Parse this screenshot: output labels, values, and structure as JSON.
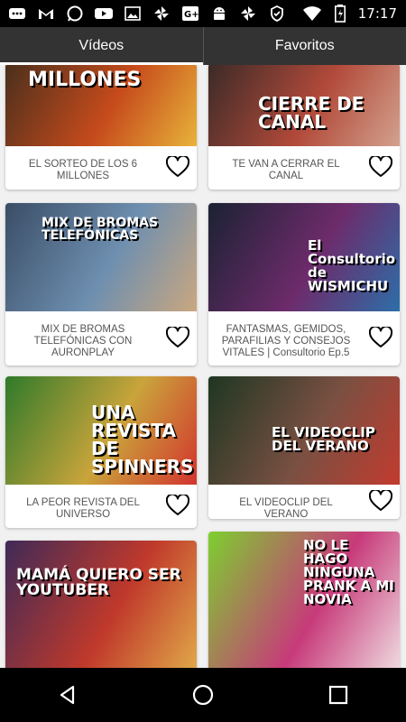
{
  "status_bar": {
    "time": "17:17",
    "icons": [
      "messages-icon",
      "gmail-icon",
      "whatsapp-icon",
      "youtube-icon",
      "gallery-icon",
      "pinwheel-icon",
      "google-plus-icon",
      "android-icon",
      "pinwheel-icon",
      "shield-icon",
      "wifi-icon",
      "battery-charging-icon"
    ]
  },
  "tabs": [
    {
      "label": "Vídeos",
      "active": true
    },
    {
      "label": "Favoritos",
      "active": false
    }
  ],
  "cards": [
    {
      "caption": "EL SORTEO DE LOS 6 MILLONES",
      "thumb_text": "MILLONES",
      "colors": [
        "#4a2f1c",
        "#c64b1c",
        "#e8b33a"
      ],
      "favorite": false
    },
    {
      "caption": "TE VAN A CERRAR EL CANAL",
      "thumb_text": "CIERRE DE CANAL",
      "colors": [
        "#3b2a27",
        "#b24a3a",
        "#d3a18e"
      ],
      "favorite": false
    },
    {
      "caption": "MIX DE BROMAS TELEFÓNICAS CON AURONPLAY",
      "thumb_text": "MIX DE BROMAS TELEFÓNICAS",
      "colors": [
        "#3a4d66",
        "#6e8fb0",
        "#caa77f"
      ],
      "favorite": false
    },
    {
      "caption": "FANTASMAS, GEMIDOS, PARAFILIAS Y CONSEJOS VITALES | Consultorio Ep.5",
      "thumb_text": "El Consultorio de WISMICHU",
      "colors": [
        "#1b2233",
        "#6d2b6b",
        "#2d6ea8"
      ],
      "favorite": false
    },
    {
      "caption": "LA PEOR REVISTA DEL UNIVERSO",
      "thumb_text": "UNA REVISTA DE SPINNERS",
      "colors": [
        "#2f7a2a",
        "#c9a43b",
        "#d3342e"
      ],
      "favorite": false
    },
    {
      "caption": "EL VIDEOCLIP DEL VERANO",
      "thumb_text": "EL VIDEOCLIP DEL VERANO",
      "colors": [
        "#1e3622",
        "#7a5042",
        "#c23b2e"
      ],
      "favorite": false
    },
    {
      "caption": "",
      "thumb_text": "MAMÁ QUIERO SER YOUTUBER",
      "colors": [
        "#3f2a57",
        "#c0392b",
        "#e3b04b"
      ],
      "favorite": false
    },
    {
      "caption": "",
      "thumb_text": "NO LE HAGO NINGUNA PRANK A MI NOVIA",
      "colors": [
        "#7dcf2f",
        "#c73a7a",
        "#f2e6e6"
      ],
      "favorite": false
    }
  ],
  "nav_bar": {
    "buttons": [
      "back-icon",
      "home-icon",
      "recents-icon"
    ]
  }
}
